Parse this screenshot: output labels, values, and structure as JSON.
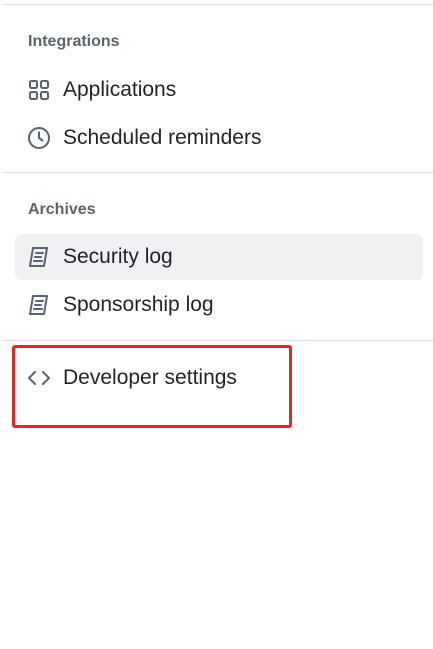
{
  "integrations": {
    "heading": "Integrations",
    "items": [
      {
        "label": "Applications",
        "icon": "apps-icon"
      },
      {
        "label": "Scheduled reminders",
        "icon": "clock-icon"
      }
    ]
  },
  "archives": {
    "heading": "Archives",
    "items": [
      {
        "label": "Security log",
        "icon": "log-icon",
        "active": true
      },
      {
        "label": "Sponsorship log",
        "icon": "log-icon",
        "active": false
      }
    ]
  },
  "developer": {
    "label": "Developer settings",
    "icon": "code-icon"
  },
  "colors": {
    "highlight": "#ee2424",
    "active_bg": "#eff1f3",
    "muted_text": "#59636e"
  }
}
